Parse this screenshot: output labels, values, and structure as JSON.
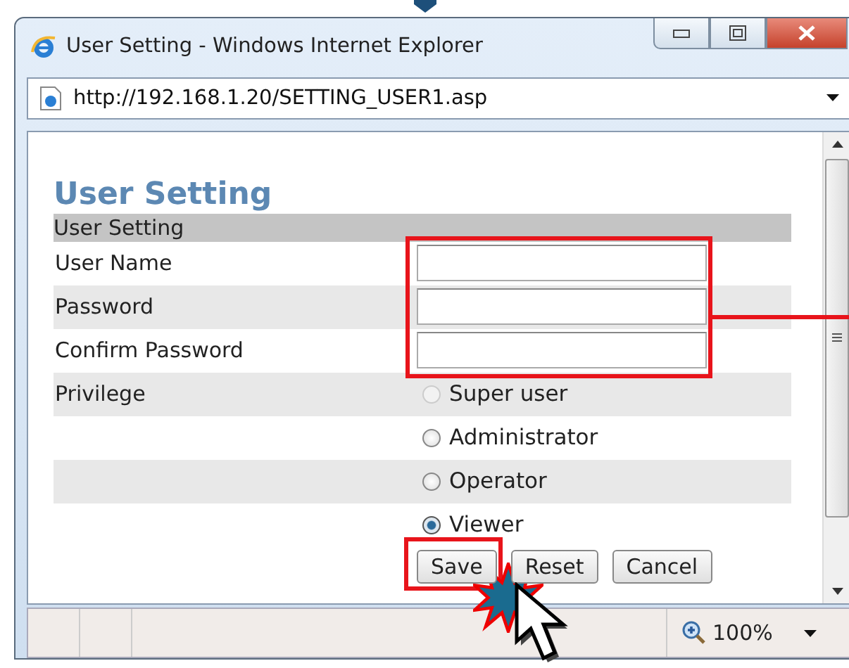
{
  "window": {
    "title": "User Setting - Windows Internet Explorer"
  },
  "address_bar": {
    "url": "http://192.168.1.20/SETTING_USER1.asp"
  },
  "page": {
    "heading": "User Setting",
    "section": "User Setting",
    "fields": [
      {
        "label": "User Name"
      },
      {
        "label": "Password"
      },
      {
        "label": "Confirm Password"
      }
    ],
    "privilege": {
      "label": "Privilege",
      "options": [
        {
          "label": "Super user",
          "selected": false,
          "disabled": true
        },
        {
          "label": "Administrator",
          "selected": false,
          "disabled": false
        },
        {
          "label": "Operator",
          "selected": false,
          "disabled": false
        },
        {
          "label": "Viewer",
          "selected": true,
          "disabled": false
        }
      ]
    },
    "buttons": [
      "Save",
      "Reset",
      "Cancel"
    ]
  },
  "status_bar": {
    "zoom": "100%"
  }
}
